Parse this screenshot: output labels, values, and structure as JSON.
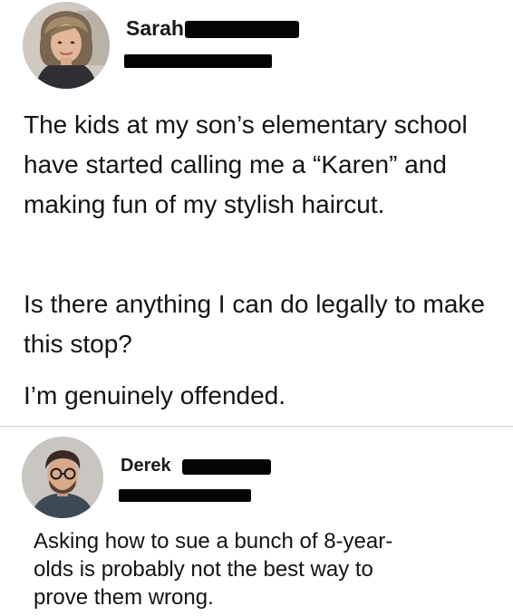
{
  "post": {
    "author": "Sarah",
    "paragraphs": [
      "The kids at my son’s elementary school have started calling me a “Karen” and making fun of my stylish haircut.",
      "Is there anything I can do legally to make this stop?",
      "I’m genuinely offended."
    ]
  },
  "reply": {
    "author": "Derek",
    "text": "Asking how to sue a bunch of 8-year-olds is probably not the best way to prove them wrong."
  },
  "colors": {
    "text": "#141414",
    "divider": "#cfcfcf",
    "redaction": "#050505"
  }
}
